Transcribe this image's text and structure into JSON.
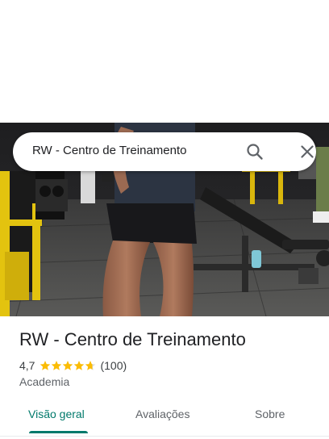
{
  "search": {
    "query": "RW - Centro de Treinamento"
  },
  "place": {
    "name": "RW - Centro de Treinamento",
    "rating_text": "4,7",
    "rating_value": 4.7,
    "review_count": "(100)",
    "category": "Academia"
  },
  "tabs": [
    {
      "label": "Visão geral",
      "active": true
    },
    {
      "label": "Avaliações",
      "active": false
    },
    {
      "label": "Sobre",
      "active": false
    }
  ],
  "colors": {
    "accent": "#00796b",
    "star": "#fbbc04",
    "text": "#202124",
    "secondary_text": "#5f6368"
  },
  "icons": {
    "search": "search-icon",
    "close": "close-icon",
    "star": "star-icon"
  }
}
